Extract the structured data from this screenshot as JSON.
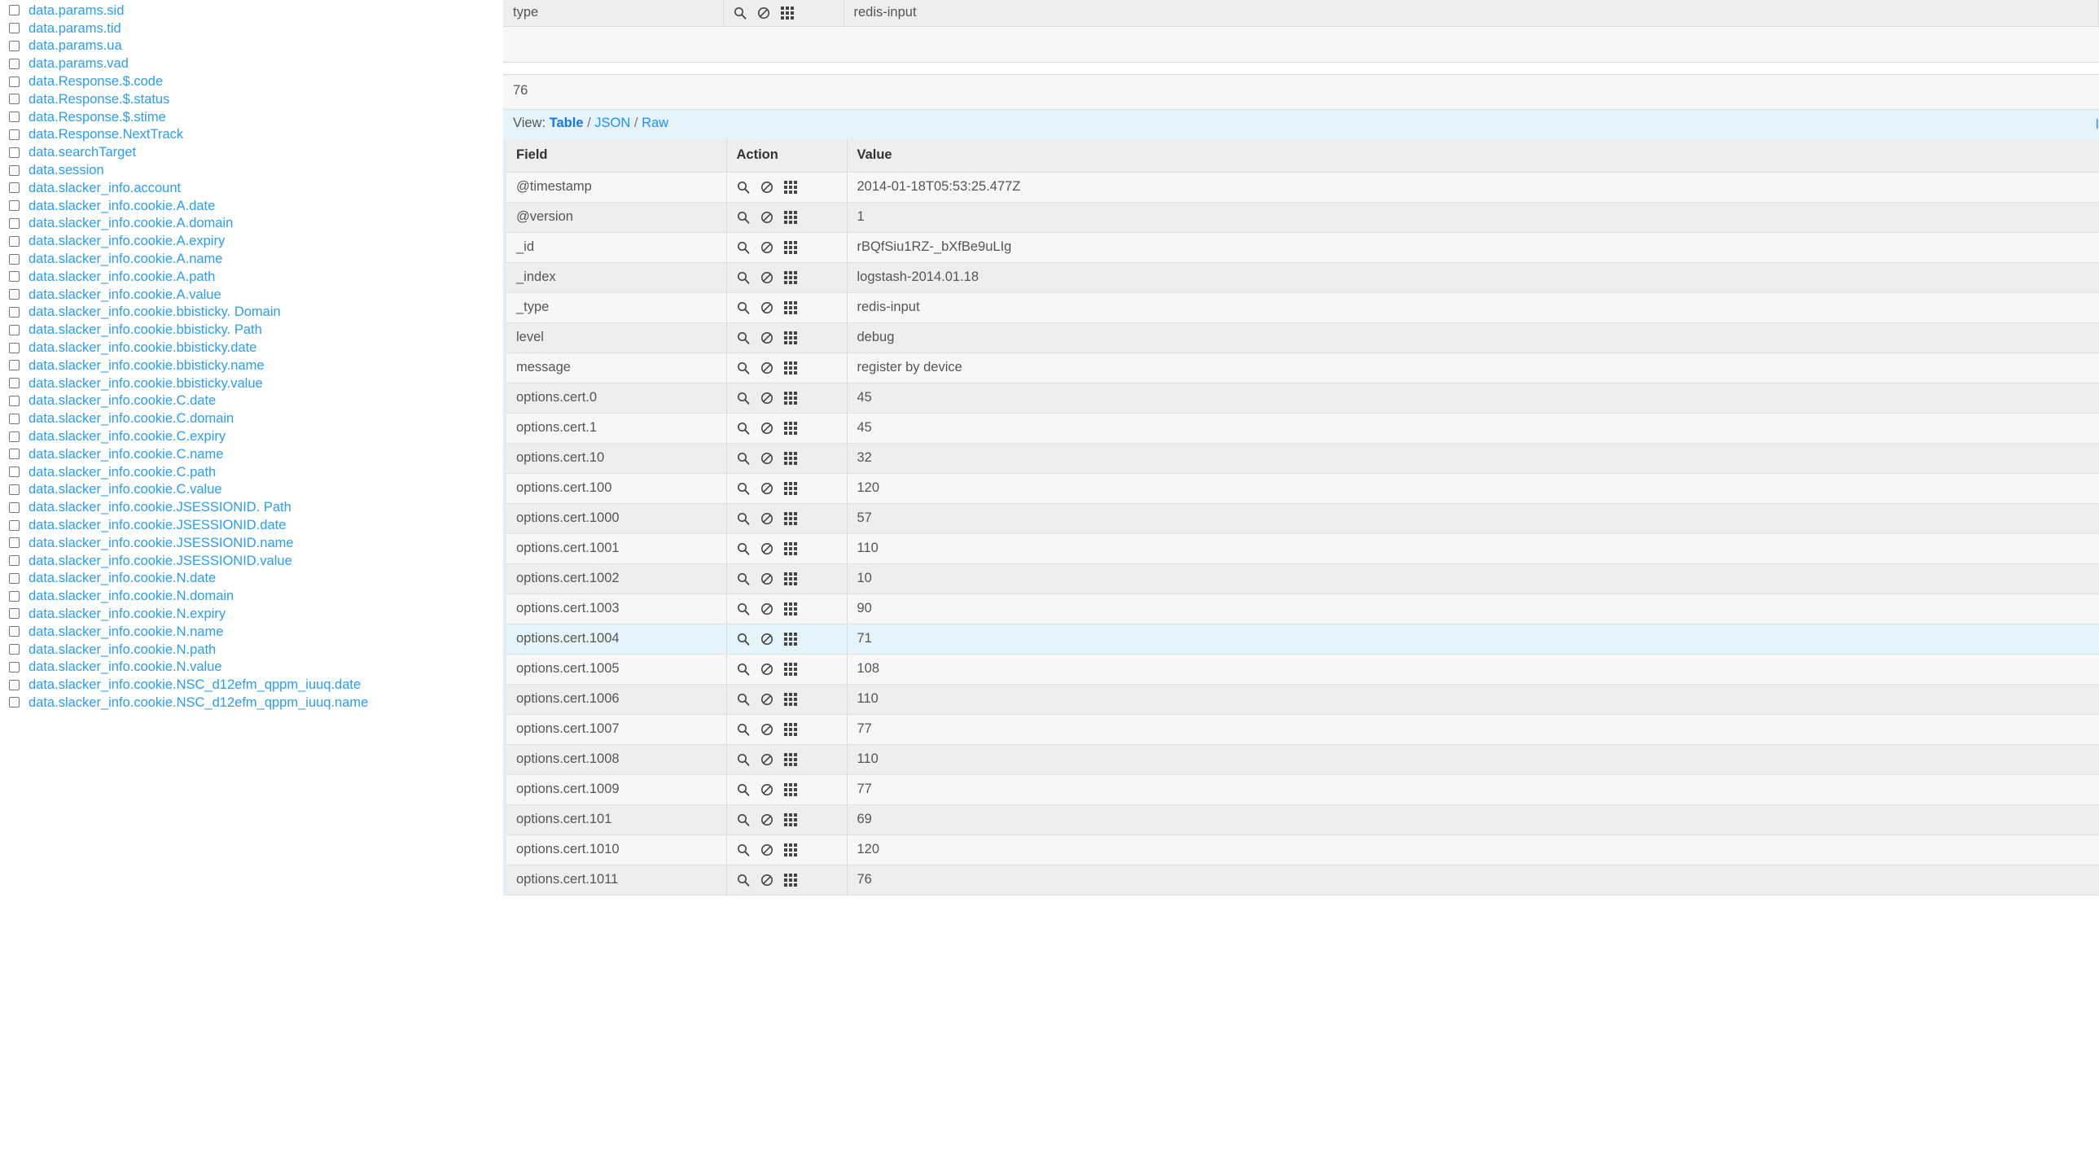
{
  "sidebar": {
    "fields": [
      "data.params.sid",
      "data.params.tid",
      "data.params.ua",
      "data.params.vad",
      "data.Response.$.code",
      "data.Response.$.status",
      "data.Response.$.stime",
      "data.Response.NextTrack",
      "data.searchTarget",
      "data.session",
      "data.slacker_info.account",
      "data.slacker_info.cookie.A.date",
      "data.slacker_info.cookie.A.domain",
      "data.slacker_info.cookie.A.expiry",
      "data.slacker_info.cookie.A.name",
      "data.slacker_info.cookie.A.path",
      "data.slacker_info.cookie.A.value",
      "data.slacker_info.cookie.bbisticky. Domain",
      "data.slacker_info.cookie.bbisticky. Path",
      "data.slacker_info.cookie.bbisticky.date",
      "data.slacker_info.cookie.bbisticky.name",
      "data.slacker_info.cookie.bbisticky.value",
      "data.slacker_info.cookie.C.date",
      "data.slacker_info.cookie.C.domain",
      "data.slacker_info.cookie.C.expiry",
      "data.slacker_info.cookie.C.name",
      "data.slacker_info.cookie.C.path",
      "data.slacker_info.cookie.C.value",
      "data.slacker_info.cookie.JSESSIONID. Path",
      "data.slacker_info.cookie.JSESSIONID.date",
      "data.slacker_info.cookie.JSESSIONID.name",
      "data.slacker_info.cookie.JSESSIONID.value",
      "data.slacker_info.cookie.N.date",
      "data.slacker_info.cookie.N.domain",
      "data.slacker_info.cookie.N.expiry",
      "data.slacker_info.cookie.N.name",
      "data.slacker_info.cookie.N.path",
      "data.slacker_info.cookie.N.value",
      "data.slacker_info.cookie.NSC_d12efm_qppm_iuuq.date",
      "data.slacker_info.cookie.NSC_d12efm_qppm_iuuq.name"
    ]
  },
  "top_row": {
    "field": "type",
    "value": "redis-input"
  },
  "count": "76",
  "view": {
    "label": "View:",
    "options": [
      {
        "label": "Table",
        "active": true
      },
      {
        "label": "JSON",
        "active": false
      },
      {
        "label": "Raw",
        "active": false
      }
    ],
    "separator": "/"
  },
  "table": {
    "columns": [
      "Field",
      "Action",
      "Value"
    ],
    "rows": [
      {
        "field": "@timestamp",
        "value": "2014-01-18T05:53:25.477Z",
        "highlight": false
      },
      {
        "field": "@version",
        "value": "1",
        "highlight": false
      },
      {
        "field": "_id",
        "value": "rBQfSiu1RZ-_bXfBe9uLIg",
        "highlight": false
      },
      {
        "field": "_index",
        "value": "logstash-2014.01.18",
        "highlight": false
      },
      {
        "field": "_type",
        "value": "redis-input",
        "highlight": false
      },
      {
        "field": "level",
        "value": "debug",
        "highlight": false
      },
      {
        "field": "message",
        "value": "register by device",
        "highlight": false
      },
      {
        "field": "options.cert.0",
        "value": "45",
        "highlight": false
      },
      {
        "field": "options.cert.1",
        "value": "45",
        "highlight": false
      },
      {
        "field": "options.cert.10",
        "value": "32",
        "highlight": false
      },
      {
        "field": "options.cert.100",
        "value": "120",
        "highlight": false
      },
      {
        "field": "options.cert.1000",
        "value": "57",
        "highlight": false
      },
      {
        "field": "options.cert.1001",
        "value": "110",
        "highlight": false
      },
      {
        "field": "options.cert.1002",
        "value": "10",
        "highlight": false
      },
      {
        "field": "options.cert.1003",
        "value": "90",
        "highlight": false
      },
      {
        "field": "options.cert.1004",
        "value": "71",
        "highlight": true
      },
      {
        "field": "options.cert.1005",
        "value": "108",
        "highlight": false
      },
      {
        "field": "options.cert.1006",
        "value": "110",
        "highlight": false
      },
      {
        "field": "options.cert.1007",
        "value": "77",
        "highlight": false
      },
      {
        "field": "options.cert.1008",
        "value": "110",
        "highlight": false
      },
      {
        "field": "options.cert.1009",
        "value": "77",
        "highlight": false
      },
      {
        "field": "options.cert.101",
        "value": "69",
        "highlight": false
      },
      {
        "field": "options.cert.1010",
        "value": "120",
        "highlight": false
      },
      {
        "field": "options.cert.1011",
        "value": "76",
        "highlight": false
      }
    ],
    "action_icons": [
      "search-icon",
      "ban-icon",
      "grid-icon"
    ]
  },
  "colors": {
    "link": "#2a9df4",
    "highlight_row": "#e5f4fb",
    "row_odd": "#f7f7f7",
    "row_even": "#eeeeee"
  }
}
